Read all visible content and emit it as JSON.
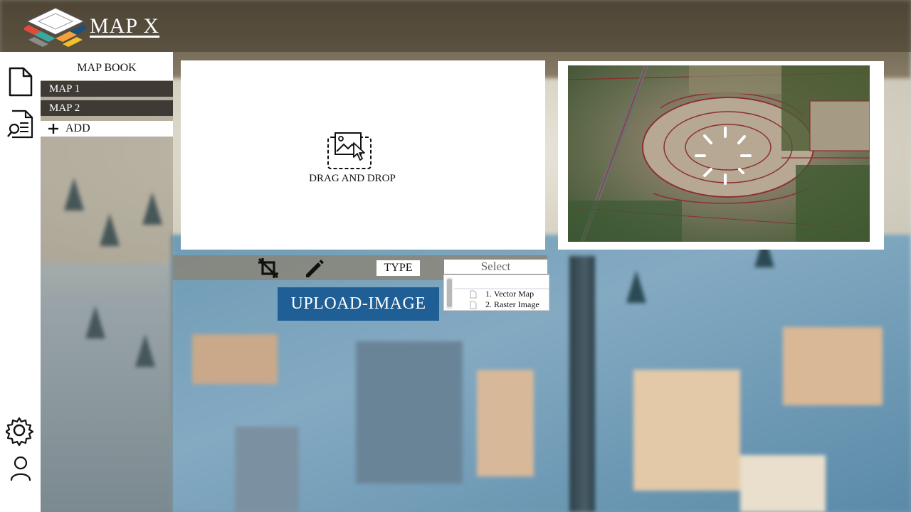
{
  "app": {
    "title": "MAP X"
  },
  "mapbook": {
    "header": "MAP BOOK",
    "items": [
      {
        "label": "MAP 1"
      },
      {
        "label": "MAP 2"
      }
    ],
    "add_label": "ADD"
  },
  "dropzone": {
    "label": "DRAG AND DROP"
  },
  "toolbar": {
    "type_label": "TYPE",
    "select_placeholder": "Select",
    "options": [
      {
        "label": "1. Vector Map"
      },
      {
        "label": "2. Raster Image"
      }
    ],
    "upload_label": "UPLOAD-IMAGE"
  },
  "icons": {
    "logo": "map-x-logo",
    "rail": [
      "document-icon",
      "search-document-icon",
      "settings-icon",
      "user-icon"
    ],
    "tools": [
      "crop-off-icon",
      "pencil-icon"
    ],
    "drop": "image-drop-icon",
    "loading": "loading-spinner-icon"
  },
  "colors": {
    "accent": "#1f5f96",
    "map_item_bg": "#3f3a35",
    "panel_bg": "#ffffff"
  }
}
